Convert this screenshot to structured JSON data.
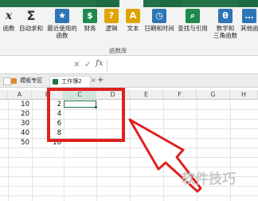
{
  "ribbon": {
    "buttons": [
      {
        "label": "函数",
        "icon": "fx-icon",
        "color": "#ffffff"
      },
      {
        "label": "自动求和",
        "icon": "sigma-icon",
        "color": "#ffffff"
      },
      {
        "label": "最近使用的",
        "label2": "函数",
        "icon": "star-icon",
        "color": "#2e75b6"
      },
      {
        "label": "财务",
        "icon": "book-icon",
        "color": "#1f8a4c"
      },
      {
        "label": "逻辑",
        "icon": "question-book-icon",
        "color": "#e0a400"
      },
      {
        "label": "文本",
        "icon": "text-book-icon",
        "color": "#e0a400"
      },
      {
        "label": "日期和时间",
        "icon": "clock-book-icon",
        "color": "#2e75b6"
      },
      {
        "label": "查找与引用",
        "icon": "search-book-icon",
        "color": "#1f8a4c"
      },
      {
        "label": "数学和",
        "label2": "三角函数",
        "icon": "theta-book-icon",
        "color": "#2e75b6"
      },
      {
        "label": "其他函",
        "icon": "more-book-icon",
        "color": "#2e75b6"
      }
    ],
    "group_label": "函数库"
  },
  "formula_bar": {
    "fx": "fx"
  },
  "tabs": [
    {
      "label": "模板专区"
    },
    {
      "label": "工作簿2"
    }
  ],
  "columns": [
    "A",
    "B",
    "C",
    "D",
    "E",
    "F",
    "G",
    "H"
  ],
  "rows": [
    {
      "a": "10",
      "b": "2"
    },
    {
      "a": "20",
      "b": "4"
    },
    {
      "a": "30",
      "b": "6"
    },
    {
      "a": "40",
      "b": "8"
    },
    {
      "a": "50",
      "b": "10"
    }
  ],
  "accent": "#217346",
  "highlight": "#e02020",
  "watermark": "软件技巧"
}
